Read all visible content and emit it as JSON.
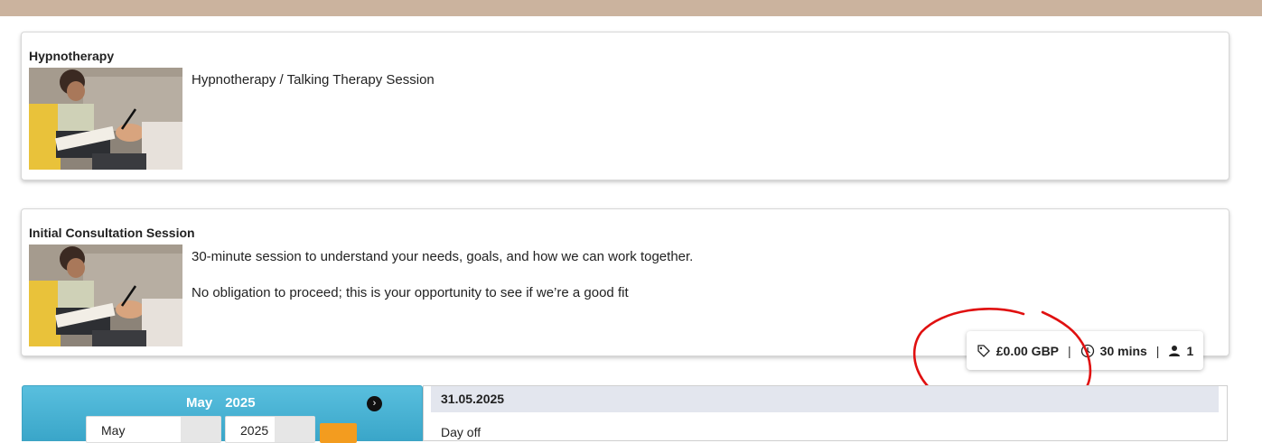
{
  "services": [
    {
      "title": "Hypnotherapy",
      "description": [
        "Hypnotherapy / Talking Therapy Session"
      ]
    },
    {
      "title": "Initial Consultation Session",
      "description": [
        "30-minute session to understand your needs, goals, and how we can work together.",
        "No obligation to proceed; this is your opportunity to see if we’re a good fit"
      ],
      "info": {
        "price": "£0.00 GBP",
        "duration": "30 mins",
        "capacity": "1",
        "separator": "|"
      }
    }
  ],
  "calendar": {
    "month": "May",
    "year": "2025",
    "month_select": "May",
    "year_select": "2025",
    "next_icon": "chevron-right-icon"
  },
  "day": {
    "date": "31.05.2025",
    "status": "Day off"
  },
  "colors": {
    "top_band": "#cbb39e",
    "calendar_header": "#4ab3d6",
    "go_button": "#f39c1f",
    "annotation": "#e01010"
  }
}
